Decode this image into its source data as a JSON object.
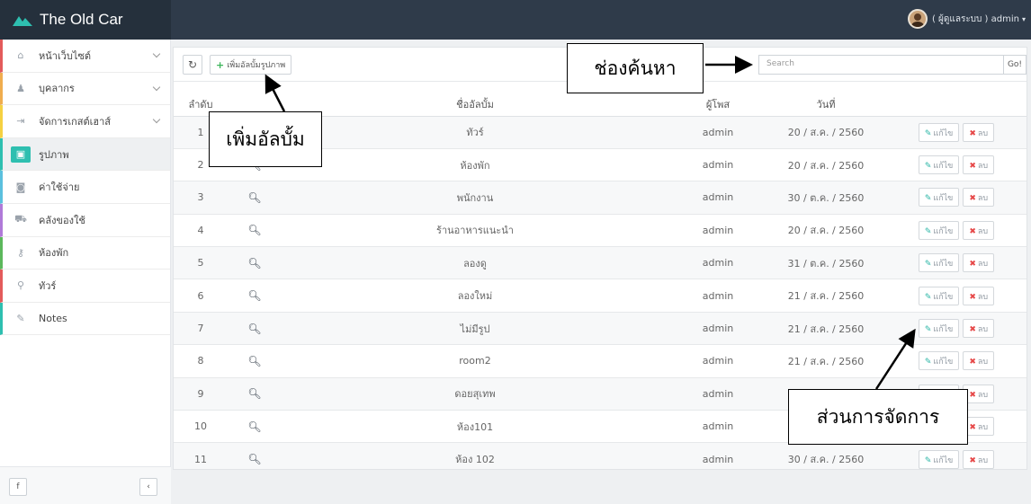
{
  "app": {
    "title": "The Old Car"
  },
  "user": {
    "label": "( ผู้ดูแลระบบ ) admin"
  },
  "sidebar": {
    "items": [
      {
        "icon": "home-icon",
        "label": "หน้าเว็บไซต์",
        "glyph": "⌂"
      },
      {
        "icon": "user-icon",
        "label": "บุคลากร",
        "glyph": "♟"
      },
      {
        "icon": "sign-in-icon",
        "label": "จัดการเกสต์เฮาส์",
        "glyph": "⇥"
      },
      {
        "icon": "image-icon",
        "label": "รูปภาพ",
        "glyph": "▣"
      },
      {
        "icon": "money-icon",
        "label": "ค่าใช้จ่าย",
        "glyph": "◙"
      },
      {
        "icon": "cart-icon",
        "label": "คลังของใช้",
        "glyph": "⛟"
      },
      {
        "icon": "key-icon",
        "label": "ห้องพัก",
        "glyph": "⚷"
      },
      {
        "icon": "map-marker-icon",
        "label": "ทัวร์",
        "glyph": "⚲"
      },
      {
        "icon": "pencil-icon",
        "label": "Notes",
        "glyph": "✎"
      }
    ],
    "footer": {
      "facebook": "f",
      "collapse": "‹"
    }
  },
  "toolbar": {
    "refresh": "↻",
    "add_album": "เพิ่มอัลบั้มรูปภาพ",
    "search_placeholder": "Search",
    "go": "Go!"
  },
  "table": {
    "headers": {
      "no": "ลำดับ",
      "name": "ชื่ออัลบั้ม",
      "poster": "ผู้โพส",
      "date": "วันที่"
    },
    "edit_label": "แก้ไข",
    "delete_label": "ลบ",
    "zoom_glyph": "🔍︎",
    "rows": [
      {
        "no": "1",
        "name": "ทัวร์",
        "poster": "admin",
        "date": "20 / ส.ค. / 2560"
      },
      {
        "no": "2",
        "name": "ห้องพัก",
        "poster": "admin",
        "date": "20 / ส.ค. / 2560"
      },
      {
        "no": "3",
        "name": "พนักงาน",
        "poster": "admin",
        "date": "30 / ต.ค. / 2560"
      },
      {
        "no": "4",
        "name": "ร้านอาหารแนะนำ",
        "poster": "admin",
        "date": "20 / ส.ค. / 2560"
      },
      {
        "no": "5",
        "name": "ลองดู",
        "poster": "admin",
        "date": "31 / ต.ค. / 2560"
      },
      {
        "no": "6",
        "name": "ลองใหม่",
        "poster": "admin",
        "date": "21 / ส.ค. / 2560"
      },
      {
        "no": "7",
        "name": "ไม่มีรูป",
        "poster": "admin",
        "date": "21 / ส.ค. / 2560"
      },
      {
        "no": "8",
        "name": "room2",
        "poster": "admin",
        "date": "21 / ส.ค. / 2560"
      },
      {
        "no": "9",
        "name": "ดอยสุเทพ",
        "poster": "admin",
        "date": ""
      },
      {
        "no": "10",
        "name": "ห้อง101",
        "poster": "admin",
        "date": ""
      },
      {
        "no": "11",
        "name": "ห้อง 102",
        "poster": "admin",
        "date": "30 / ส.ค. / 2560"
      }
    ]
  },
  "annotations": {
    "add_album": "เพิ่มอัลบั้ม",
    "search_box": "ช่องค้นหา",
    "manage": "ส่วนการจัดการ"
  }
}
